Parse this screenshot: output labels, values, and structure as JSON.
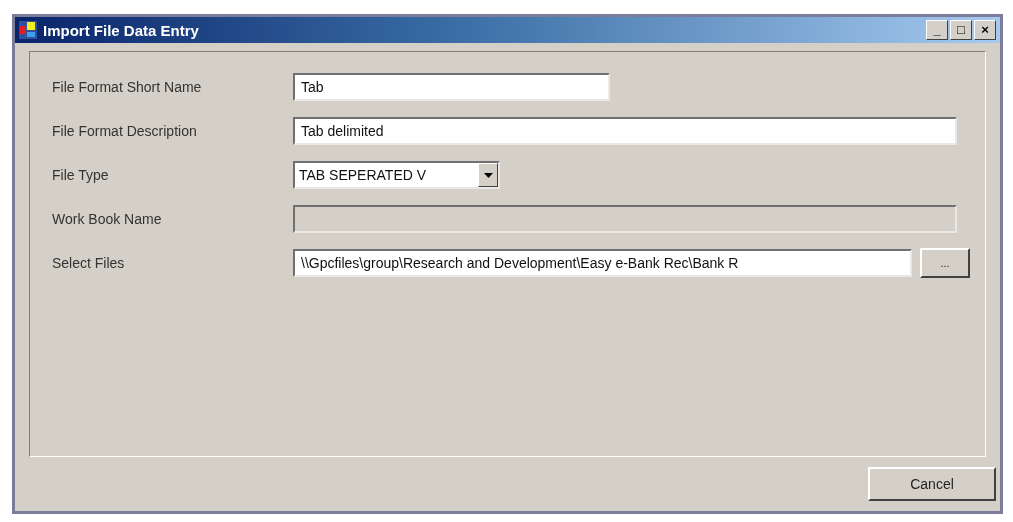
{
  "window": {
    "title": "Import File Data Entry",
    "controls": [
      "_",
      "□",
      "×"
    ]
  },
  "fields": [
    {
      "label": "File Format Short Name",
      "kind": "text",
      "value": "Tab",
      "disabled": false
    },
    {
      "label": "File Format Description",
      "kind": "text",
      "value": "Tab delimited",
      "disabled": false
    },
    {
      "label": "File Type",
      "kind": "combo",
      "value": "TAB SEPERATED V",
      "disabled": false
    },
    {
      "label": "Work Book Name",
      "kind": "text",
      "disabled": true
    },
    {
      "label": "Select Files",
      "kind": "browse",
      "value": "\\\\Gpcfiles\\group\\Research and Development\\Easy e-Bank Rec\\Bank R",
      "button": "...",
      "disabled": false
    }
  ],
  "buttons": [
    "Cancel"
  ]
}
